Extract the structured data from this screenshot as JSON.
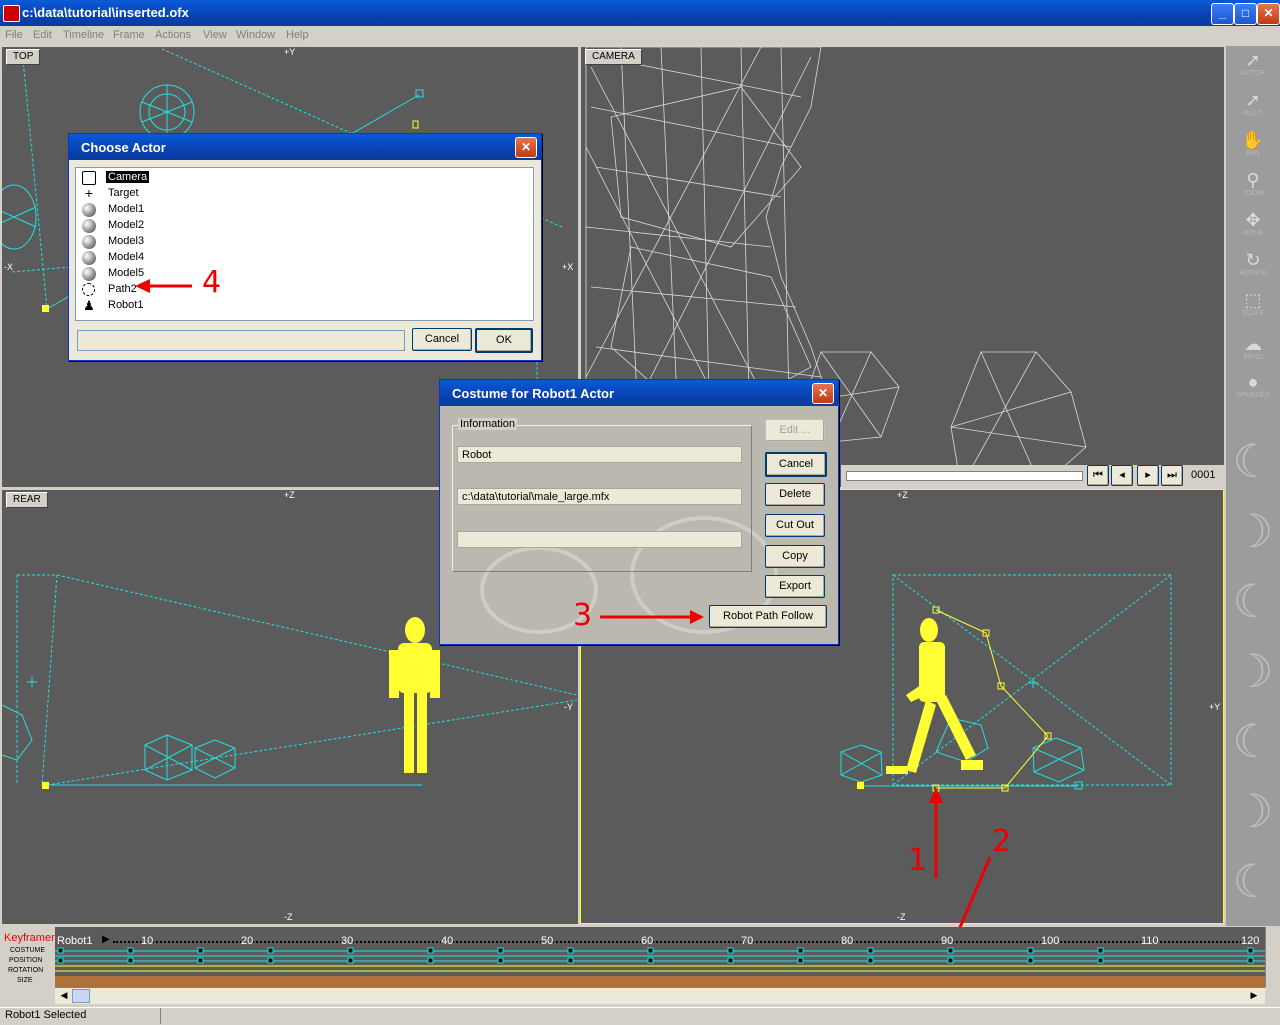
{
  "window": {
    "title": "c:\\data\\tutorial\\inserted.ofx",
    "controls": {
      "minimize": "_",
      "maximize": "□",
      "close": "✕"
    }
  },
  "menu": [
    "File",
    "Edit",
    "Timeline",
    "Frame",
    "Actions",
    "View",
    "Window",
    "Help"
  ],
  "viewports": {
    "top": {
      "label": "TOP",
      "axes": {
        "y_top": "+Y",
        "x_left": "-X",
        "x_right": "+X"
      }
    },
    "camera": {
      "label": "CAMERA",
      "frame": "0001"
    },
    "rear": {
      "label": "REAR",
      "axes": {
        "z_top": "+Z",
        "z_bottom": "-Z",
        "y_right": "-Y"
      }
    },
    "side": {
      "axes": {
        "z_top": "+Z",
        "z_bottom": "-Z",
        "y_right": "+Y"
      }
    }
  },
  "right_toolbar": [
    {
      "icon": "arrow-icon",
      "label": "ACTOR"
    },
    {
      "icon": "arrow-icon",
      "label": "MULTI"
    },
    {
      "icon": "hand-icon",
      "label": "PAN"
    },
    {
      "icon": "magnifier-icon",
      "label": "ZOOM"
    },
    {
      "icon": "move-icon",
      "label": "MOVE"
    },
    {
      "icon": "rotate-icon",
      "label": "ROTATE"
    },
    {
      "icon": "scale-icon",
      "label": "SCALE"
    },
    {
      "icon": "bend-icon",
      "label": "BEND"
    },
    {
      "icon": "spheres-icon",
      "label": "SPHERES"
    }
  ],
  "choose_actor_dialog": {
    "title": "Choose Actor",
    "actors": [
      {
        "name": "Camera",
        "icon": "camera-icon",
        "selected": true
      },
      {
        "name": "Target",
        "icon": "crosshair-icon"
      },
      {
        "name": "Model1",
        "icon": "sphere-icon"
      },
      {
        "name": "Model2",
        "icon": "sphere-icon"
      },
      {
        "name": "Model3",
        "icon": "sphere-icon"
      },
      {
        "name": "Model4",
        "icon": "sphere-icon"
      },
      {
        "name": "Model5",
        "icon": "sphere-icon"
      },
      {
        "name": "Path2",
        "icon": "path-icon"
      },
      {
        "name": "Robot1",
        "icon": "robot-icon"
      }
    ],
    "cancel": "Cancel",
    "ok": "OK"
  },
  "costume_dialog": {
    "title": "Costume for Robot1 Actor",
    "group": "Information",
    "name_field": "Robot",
    "file_field": "c:\\data\\tutorial\\male_large.mfx",
    "extra_field": "",
    "buttons": {
      "edit": "Edit ...",
      "cancel": "Cancel",
      "delete": "Delete",
      "cutout": "Cut Out",
      "copy": "Copy",
      "export": "Export",
      "robot_path_follow": "Robot Path Follow"
    }
  },
  "timeline": {
    "title": "Keyframer",
    "tracks": [
      "COSTUME",
      "POSITION",
      "ROTATION",
      "SIZE"
    ],
    "actor": "Robot1",
    "ticks": [
      "10",
      "20",
      "30",
      "40",
      "50",
      "60",
      "70",
      "80",
      "90",
      "100",
      "110",
      "120"
    ]
  },
  "annotations": [
    "1",
    "2",
    "3",
    "4"
  ],
  "status": "Robot1 Selected",
  "colors": {
    "accent": "#0a5bd8",
    "viewport": "#5b5b5b",
    "wire_cyan": "#22e0e0",
    "wire_yellow": "#ffff33",
    "annotation": "#ee0000"
  }
}
